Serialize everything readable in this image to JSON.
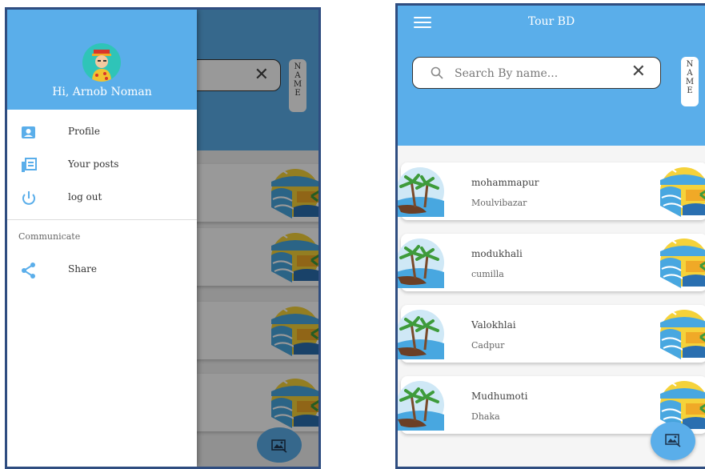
{
  "left_screen": {
    "drawer": {
      "greeting": "Hi, Arnob Noman",
      "menu": [
        {
          "label": "Profile",
          "icon": "profile-icon"
        },
        {
          "label": "Your posts",
          "icon": "posts-icon"
        },
        {
          "label": "log out",
          "icon": "power-icon"
        }
      ],
      "section_label": "Communicate",
      "share": {
        "label": "Share",
        "icon": "share-icon"
      }
    },
    "background": {
      "name_button_letters": [
        "N",
        "A",
        "M",
        "E"
      ],
      "clear_symbol": "✕"
    }
  },
  "right_screen": {
    "app_title": "Tour BD",
    "search": {
      "placeholder": "Search By name...",
      "value": "",
      "clear_symbol": "✕"
    },
    "name_button_letters": [
      "N",
      "A",
      "M",
      "E"
    ],
    "places": [
      {
        "name": "mohammapur",
        "district": "Moulvibazar"
      },
      {
        "name": "modukhali",
        "district": "cumilla"
      },
      {
        "name": "Valokhlai",
        "district": "Cadpur"
      },
      {
        "name": "Mudhumoti",
        "district": "Dhaka"
      }
    ]
  },
  "colors": {
    "primary": "#5aaeea",
    "frame": "#2f4d80",
    "background": "#f5f5f5"
  }
}
